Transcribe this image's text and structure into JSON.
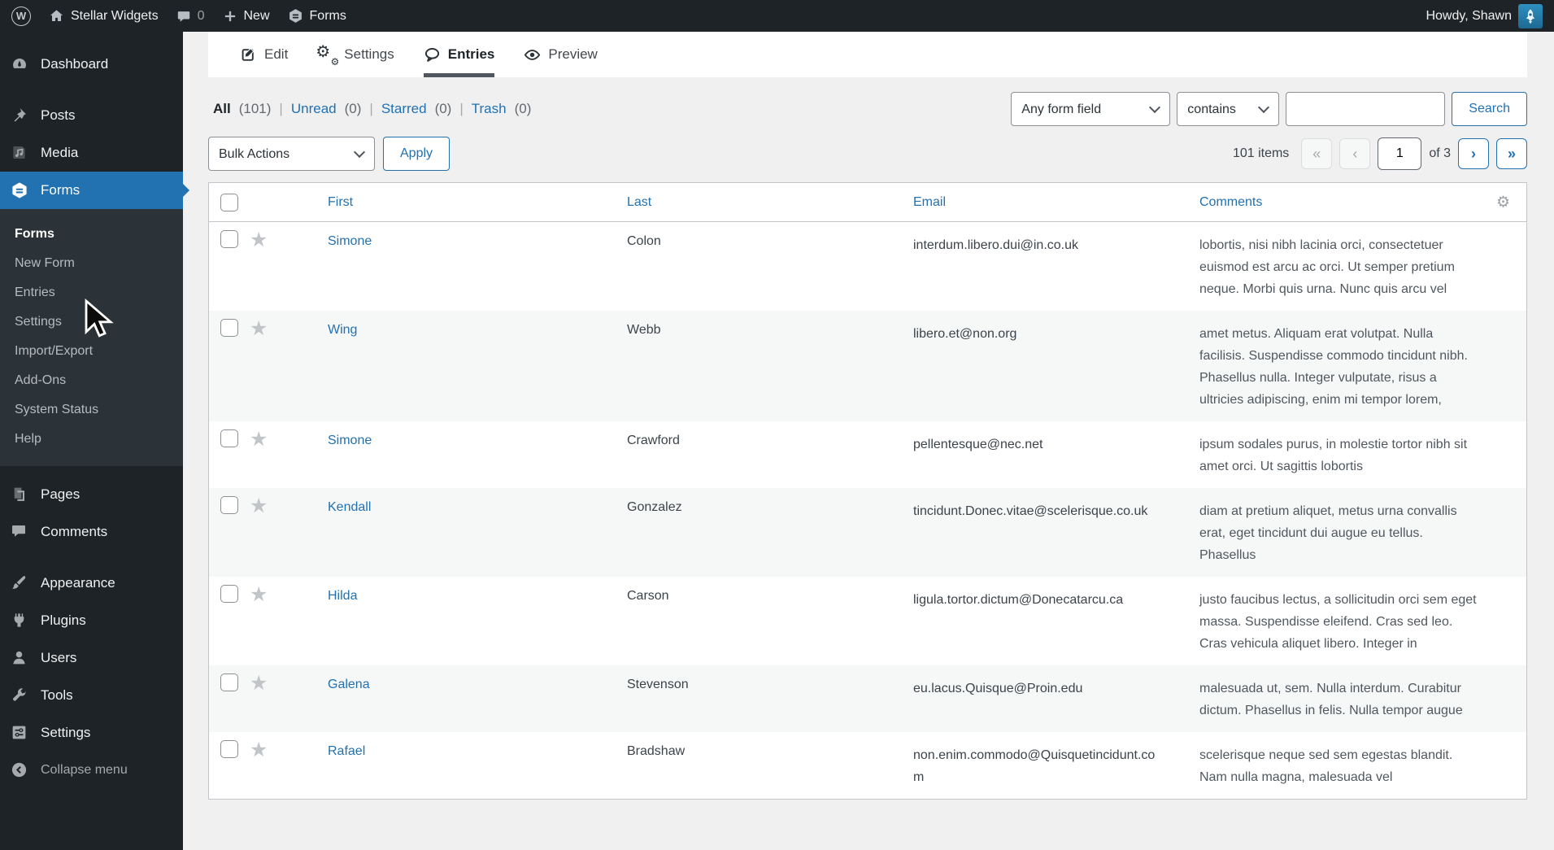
{
  "admin_bar": {
    "wp_logo_letter": "W",
    "site_name": "Stellar Widgets",
    "comments_count": "0",
    "new_label": "New",
    "forms_label": "Forms",
    "howdy": "Howdy, Shawn"
  },
  "sidebar": {
    "dashboard": "Dashboard",
    "posts": "Posts",
    "media": "Media",
    "forms": "Forms",
    "submenu": [
      "Forms",
      "New Form",
      "Entries",
      "Settings",
      "Import/Export",
      "Add-Ons",
      "System Status",
      "Help"
    ],
    "pages": "Pages",
    "comments": "Comments",
    "appearance": "Appearance",
    "plugins": "Plugins",
    "users": "Users",
    "tools": "Tools",
    "settings": "Settings",
    "collapse": "Collapse menu"
  },
  "tabs": {
    "edit": "Edit",
    "settings": "Settings",
    "entries": "Entries",
    "preview": "Preview"
  },
  "filters": {
    "all_label": "All",
    "all_count": "(101)",
    "unread_label": "Unread",
    "unread_count": "(0)",
    "starred_label": "Starred",
    "starred_count": "(0)",
    "trash_label": "Trash",
    "trash_count": "(0)",
    "separator": "|"
  },
  "search": {
    "field": "Any form field",
    "operator": "contains",
    "query": "",
    "button": "Search"
  },
  "bulk": {
    "action": "Bulk Actions",
    "apply": "Apply"
  },
  "pagination": {
    "total": "101 items",
    "first": "«",
    "prev": "‹",
    "page": "1",
    "of": "of 3",
    "next": "›",
    "last": "»"
  },
  "table": {
    "headers": {
      "first": "First",
      "last": "Last",
      "email": "Email",
      "comments": "Comments"
    },
    "rows": [
      {
        "first": "Simone",
        "last": "Colon",
        "email": "interdum.libero.dui@in.co.uk",
        "comments": "lobortis, nisi nibh lacinia orci, consectetuer euismod est arcu ac orci. Ut semper pretium neque. Morbi quis urna. Nunc quis arcu vel"
      },
      {
        "first": "Wing",
        "last": "Webb",
        "email": "libero.et@non.org",
        "comments": "amet metus. Aliquam erat volutpat. Nulla facilisis. Suspendisse commodo tincidunt nibh. Phasellus nulla. Integer vulputate, risus a ultricies adipiscing, enim mi tempor lorem,"
      },
      {
        "first": "Simone",
        "last": "Crawford",
        "email": "pellentesque@nec.net",
        "comments": "ipsum sodales purus, in molestie tortor nibh sit amet orci. Ut sagittis lobortis"
      },
      {
        "first": "Kendall",
        "last": "Gonzalez",
        "email": "tincidunt.Donec.vitae@scelerisque.co.uk",
        "comments": "diam at pretium aliquet, metus urna convallis erat, eget tincidunt dui augue eu tellus. Phasellus"
      },
      {
        "first": "Hilda",
        "last": "Carson",
        "email": "ligula.tortor.dictum@Donecatarcu.ca",
        "comments": "justo faucibus lectus, a sollicitudin orci sem eget massa. Suspendisse eleifend. Cras sed leo. Cras vehicula aliquet libero. Integer in"
      },
      {
        "first": "Galena",
        "last": "Stevenson",
        "email": "eu.lacus.Quisque@Proin.edu",
        "comments": "malesuada ut, sem. Nulla interdum. Curabitur dictum. Phasellus in felis. Nulla tempor augue"
      },
      {
        "first": "Rafael",
        "last": "Bradshaw",
        "email": "non.enim.commodo@Quisquetincidunt.com",
        "comments": "scelerisque neque sed sem egestas blandit. Nam nulla magna, malesuada vel"
      }
    ]
  },
  "colors": {
    "accent": "#2271b1",
    "admin_bar_bg": "#1d2327",
    "submenu_bg": "#2c3338",
    "content_bg": "#f0f0f1",
    "stripe": "#f6f7f7",
    "border": "#c3c4c7"
  }
}
